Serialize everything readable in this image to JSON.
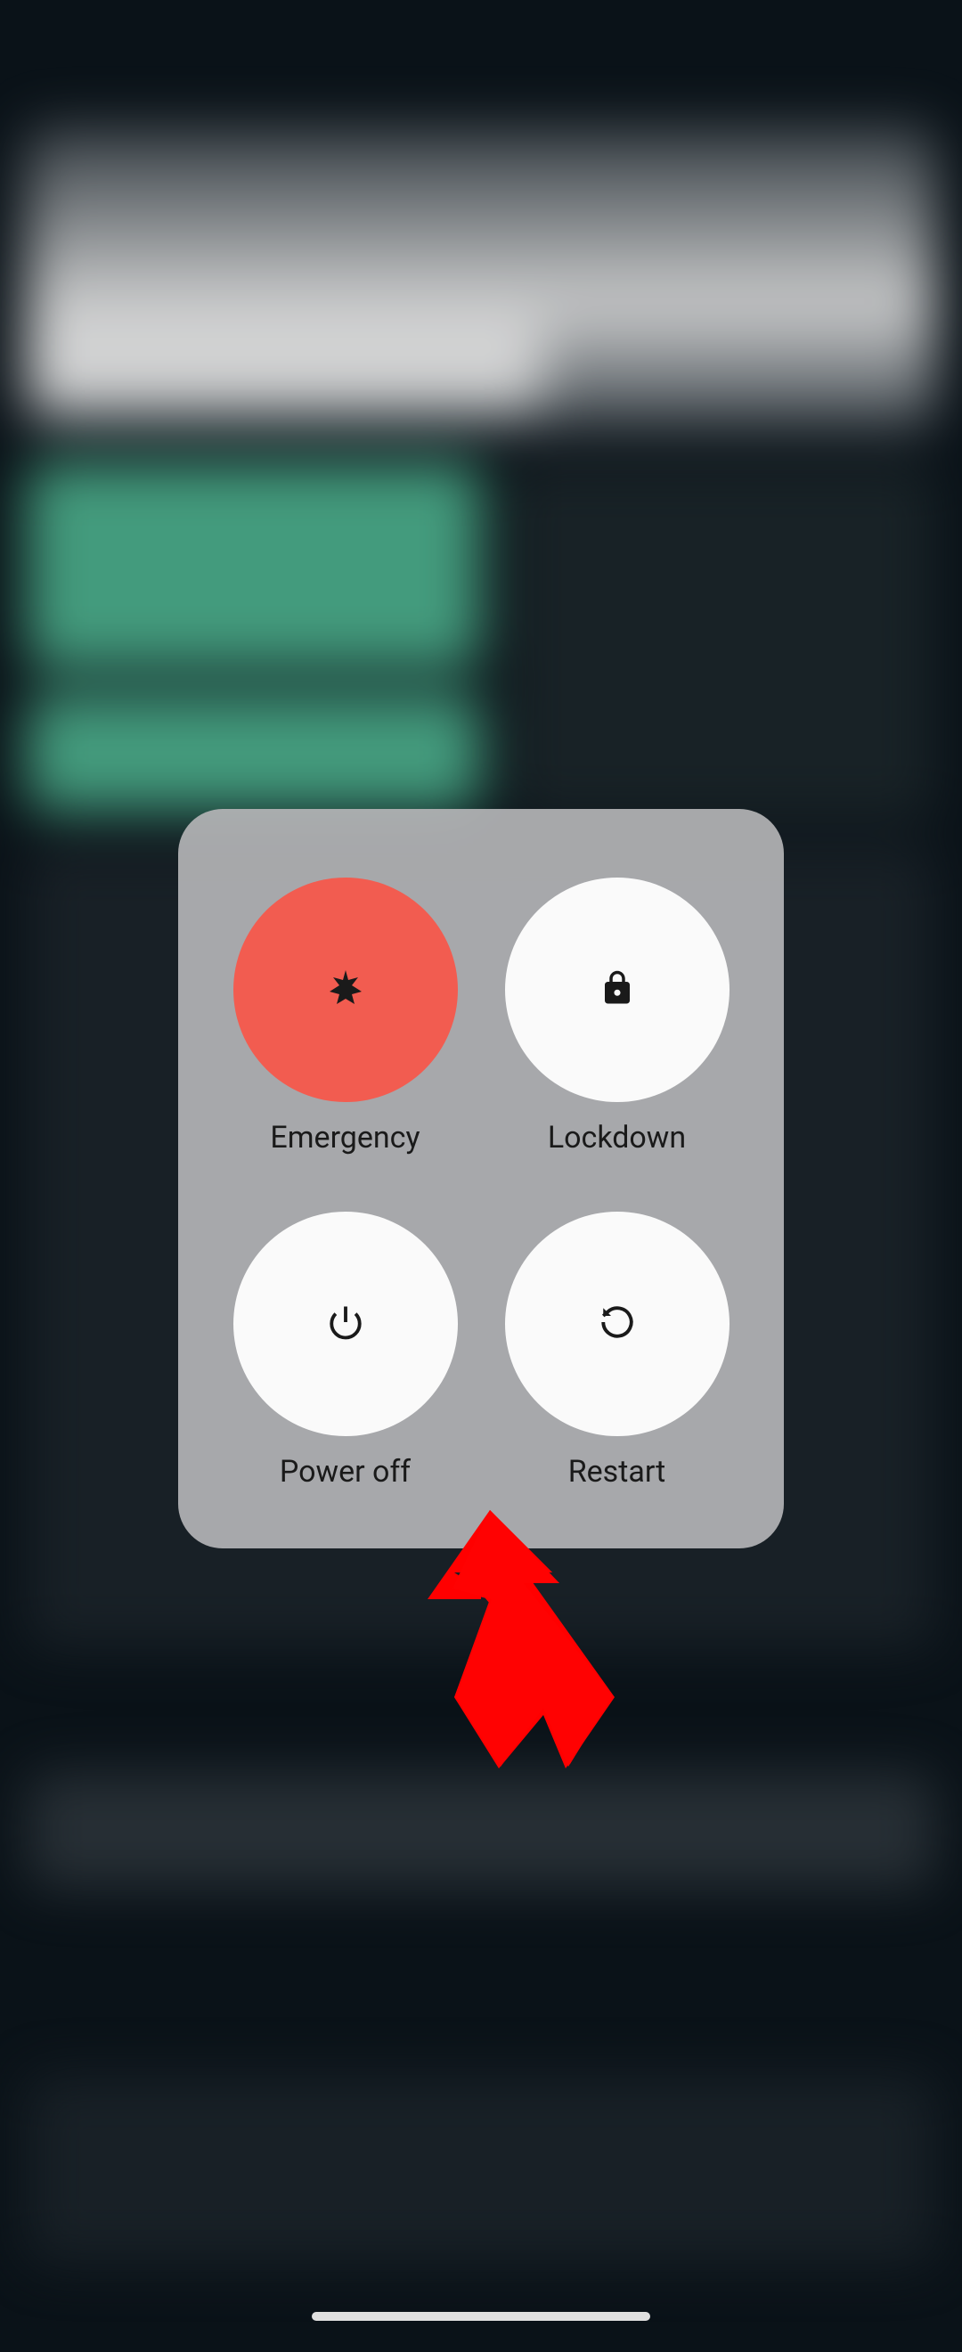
{
  "powerMenu": {
    "emergency": {
      "label": "Emergency",
      "iconName": "asterisk-icon",
      "circleColor": "#f25c50"
    },
    "lockdown": {
      "label": "Lockdown",
      "iconName": "lock-icon",
      "circleColor": "#fafafa"
    },
    "powerOff": {
      "label": "Power off",
      "iconName": "power-icon",
      "circleColor": "#fafafa"
    },
    "restart": {
      "label": "Restart",
      "iconName": "restart-icon",
      "circleColor": "#fafafa"
    }
  },
  "annotation": {
    "arrowColor": "#ff0000",
    "target": "power-off-button"
  }
}
